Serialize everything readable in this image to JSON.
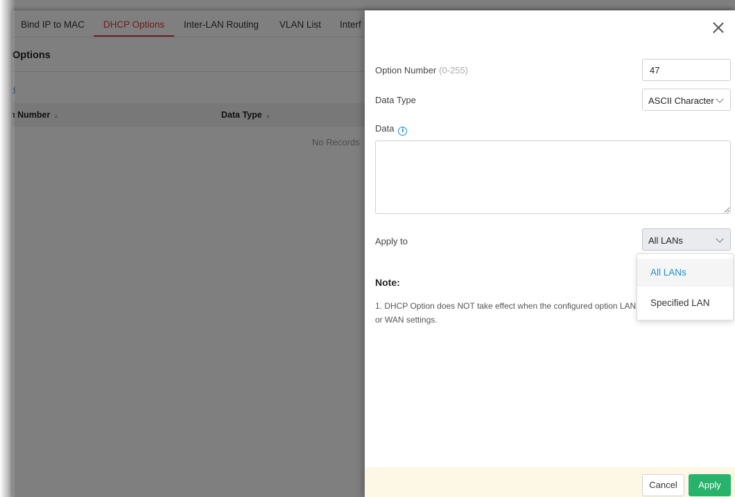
{
  "background": {
    "tabs": [
      "Bind IP to MAC",
      "DHCP Options",
      "Inter-LAN Routing",
      "VLAN List",
      "Interf"
    ],
    "active_tab": "DHCP Options",
    "section_title": "Options",
    "add_fragment": "d",
    "columns": [
      "n Number",
      "Data Type"
    ],
    "empty_text": "No Records"
  },
  "drawer": {
    "option_number": {
      "label": "Option Number",
      "hint": "(0-255)",
      "value": "47"
    },
    "data_type": {
      "label": "Data Type",
      "value": "ASCII Character"
    },
    "data": {
      "label": "Data",
      "value": "",
      "icon": "info-icon"
    },
    "apply_to": {
      "label": "Apply to",
      "value": "All LANs",
      "options": [
        "All LANs",
        "Specified LAN"
      ]
    },
    "note_title": "Note:",
    "note_text": "1. DHCP Option does NOT take effect when the configured option LAN or WAN settings.",
    "cancel_label": "Cancel",
    "apply_label": "Apply",
    "close_icon": "close-icon"
  },
  "colors": {
    "active_tab": "#d9363e",
    "accent_blue": "#1a8fd6",
    "apply_green": "#27b36b",
    "footer_bg": "#fdf8e5"
  }
}
